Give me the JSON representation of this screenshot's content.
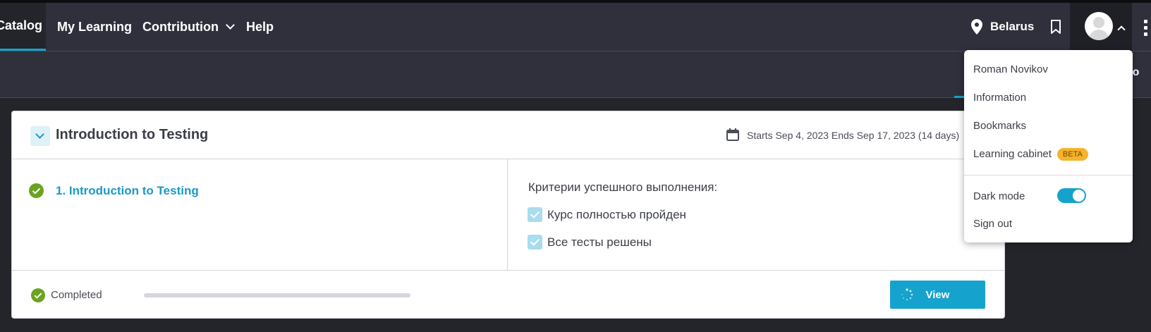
{
  "topnav": {
    "items": [
      {
        "label": "Catalog"
      },
      {
        "label": "My Learning"
      },
      {
        "label": "Contribution"
      },
      {
        "label": "Help"
      }
    ],
    "location": "Belarus"
  },
  "subnav": {
    "partial_tab": "pilo"
  },
  "course": {
    "title": "Introduction to Testing",
    "dates": "Starts Sep 4, 2023 Ends Sep 17, 2023 (14 days)",
    "module_title": "1. Introduction to Testing",
    "criteria_title": "Критерии успешного выполнения:",
    "criteria": [
      {
        "label": "Курс полностью пройден",
        "checked": true
      },
      {
        "label": "Все тесты решены",
        "checked": true
      }
    ],
    "status": "Completed",
    "progress_percent": 100,
    "view_label": "View"
  },
  "user_menu": {
    "user_name": "Roman Novikov",
    "information": "Information",
    "bookmarks": "Bookmarks",
    "learning_cabinet": "Learning cabinet",
    "beta_badge": "BETA",
    "dark_mode": "Dark mode",
    "dark_mode_on": true,
    "sign_out": "Sign out"
  },
  "colors": {
    "accent": "#15a3cd",
    "success": "#6aa31c",
    "beta": "#f7b32b",
    "header_bg": "#2f303c",
    "page_bg": "#24252b"
  }
}
